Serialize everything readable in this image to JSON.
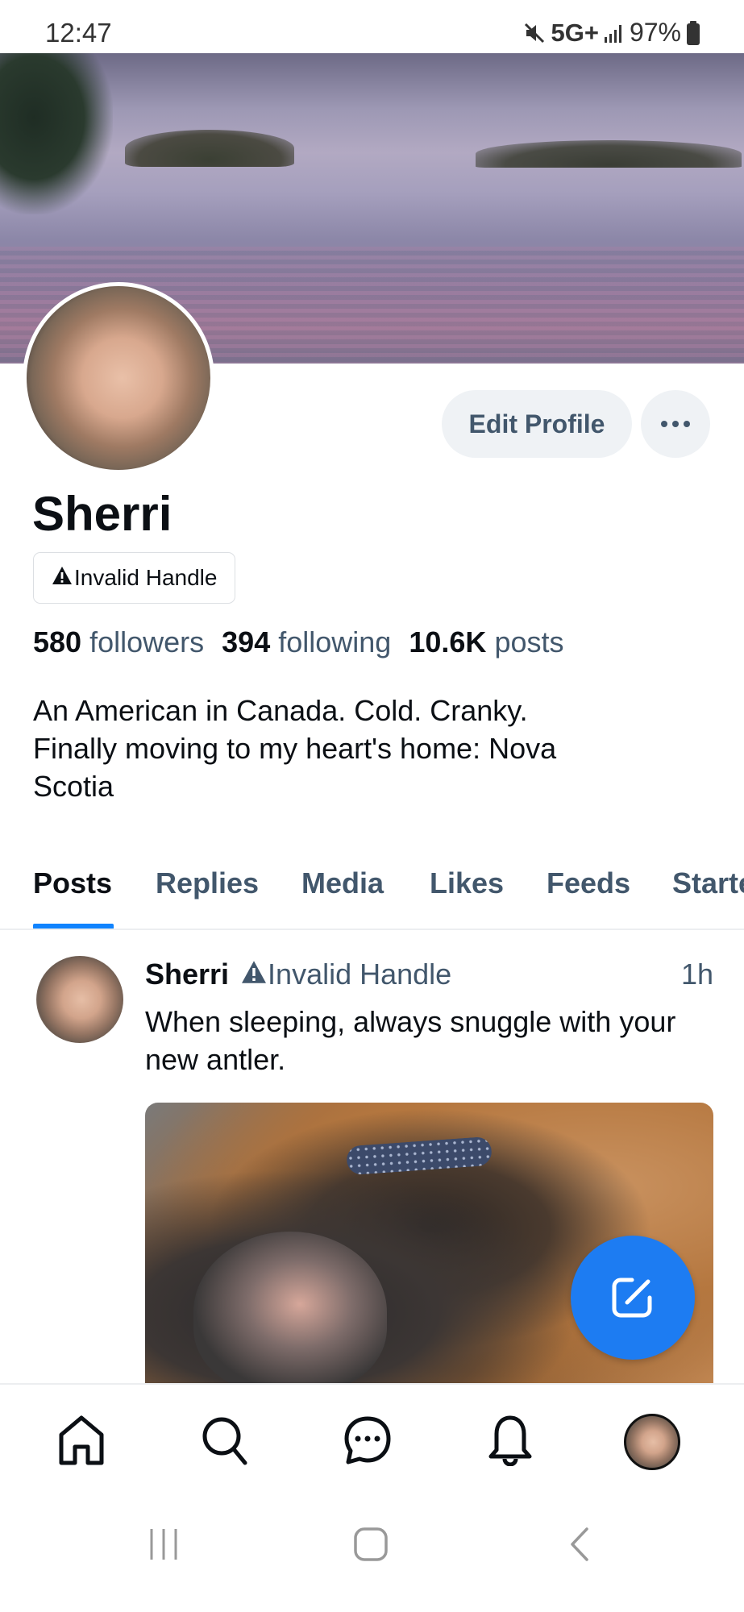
{
  "status_bar": {
    "time": "12:47",
    "network": "5G+",
    "battery": "97%",
    "icons": [
      "mute-icon",
      "signal-icon",
      "battery-icon"
    ]
  },
  "profile": {
    "display_name": "Sherri",
    "handle": "Invalid Handle",
    "handle_icon": "warning-icon",
    "edit_button_label": "Edit Profile",
    "more_button_icon": "ellipsis-icon",
    "stats": {
      "followers_count": "580",
      "followers_label": "followers",
      "following_count": "394",
      "following_label": "following",
      "posts_count": "10.6K",
      "posts_label": "posts"
    },
    "bio": "An American in Canada. Cold. Cranky.\nFinally moving to my heart's home: Nova\nScotia"
  },
  "tabs": [
    {
      "label": "Posts",
      "active": true
    },
    {
      "label": "Replies",
      "active": false
    },
    {
      "label": "Media",
      "active": false
    },
    {
      "label": "Likes",
      "active": false
    },
    {
      "label": "Feeds",
      "active": false
    },
    {
      "label": "Starter Packs",
      "active": false
    }
  ],
  "posts": [
    {
      "author": "Sherri",
      "handle": "Invalid Handle",
      "time": "1h",
      "text": "When sleeping, always snuggle with your new antler.",
      "image_alt": "Dog sleeping curled up with a collar"
    }
  ],
  "fab": {
    "icon": "compose-icon"
  },
  "bottom_nav": [
    {
      "name": "home",
      "icon": "home-icon"
    },
    {
      "name": "search",
      "icon": "search-icon"
    },
    {
      "name": "chat",
      "icon": "chat-icon"
    },
    {
      "name": "notifications",
      "icon": "bell-icon"
    },
    {
      "name": "profile",
      "icon": "avatar"
    }
  ],
  "system_nav": [
    {
      "name": "recents",
      "icon": "recents-icon"
    },
    {
      "name": "home",
      "icon": "home-circle-icon"
    },
    {
      "name": "back",
      "icon": "back-icon"
    }
  ],
  "colors": {
    "accent": "#1083fe",
    "fab": "#1d7cf2",
    "secondary_text": "#42576c",
    "button_bg": "#eff2f5",
    "primary_text": "#0b0f14"
  }
}
